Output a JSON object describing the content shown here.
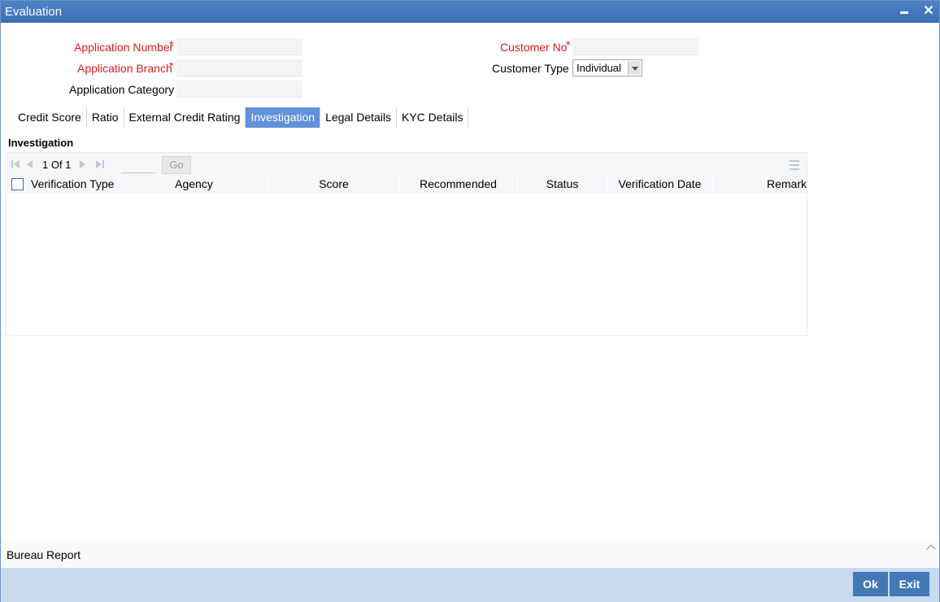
{
  "window": {
    "title": "Evaluation"
  },
  "form": {
    "application_number": {
      "label": "Application Number",
      "value": ""
    },
    "application_branch": {
      "label": "Application Branch",
      "value": ""
    },
    "application_category": {
      "label": "Application Category",
      "value": ""
    },
    "customer_no": {
      "label": "Customer No",
      "value": ""
    },
    "customer_type": {
      "label": "Customer Type",
      "value": "Individual"
    },
    "required_marker": "*"
  },
  "tabs": [
    {
      "label": "Credit Score",
      "active": false
    },
    {
      "label": "Ratio",
      "active": false
    },
    {
      "label": "External Credit Rating",
      "active": false
    },
    {
      "label": "Investigation",
      "active": true
    },
    {
      "label": "Legal Details",
      "active": false
    },
    {
      "label": "KYC Details",
      "active": false
    }
  ],
  "investigation": {
    "title": "Investigation",
    "pager": {
      "text": "1 Of 1",
      "go_label": "Go",
      "page_value": ""
    },
    "columns": [
      "Verification Type",
      "Agency",
      "Score",
      "Recommended",
      "Status",
      "Verification Date",
      "Remark"
    ],
    "rows": []
  },
  "footer": {
    "bureau_report": "Bureau Report"
  },
  "actions": {
    "ok": "Ok",
    "exit": "Exit"
  },
  "colors": {
    "title_bar": "#3f76bc",
    "active_tab": "#5f92d8",
    "required": "#d21e1e",
    "button": "#4279b4",
    "action_bar": "#c8daee"
  }
}
